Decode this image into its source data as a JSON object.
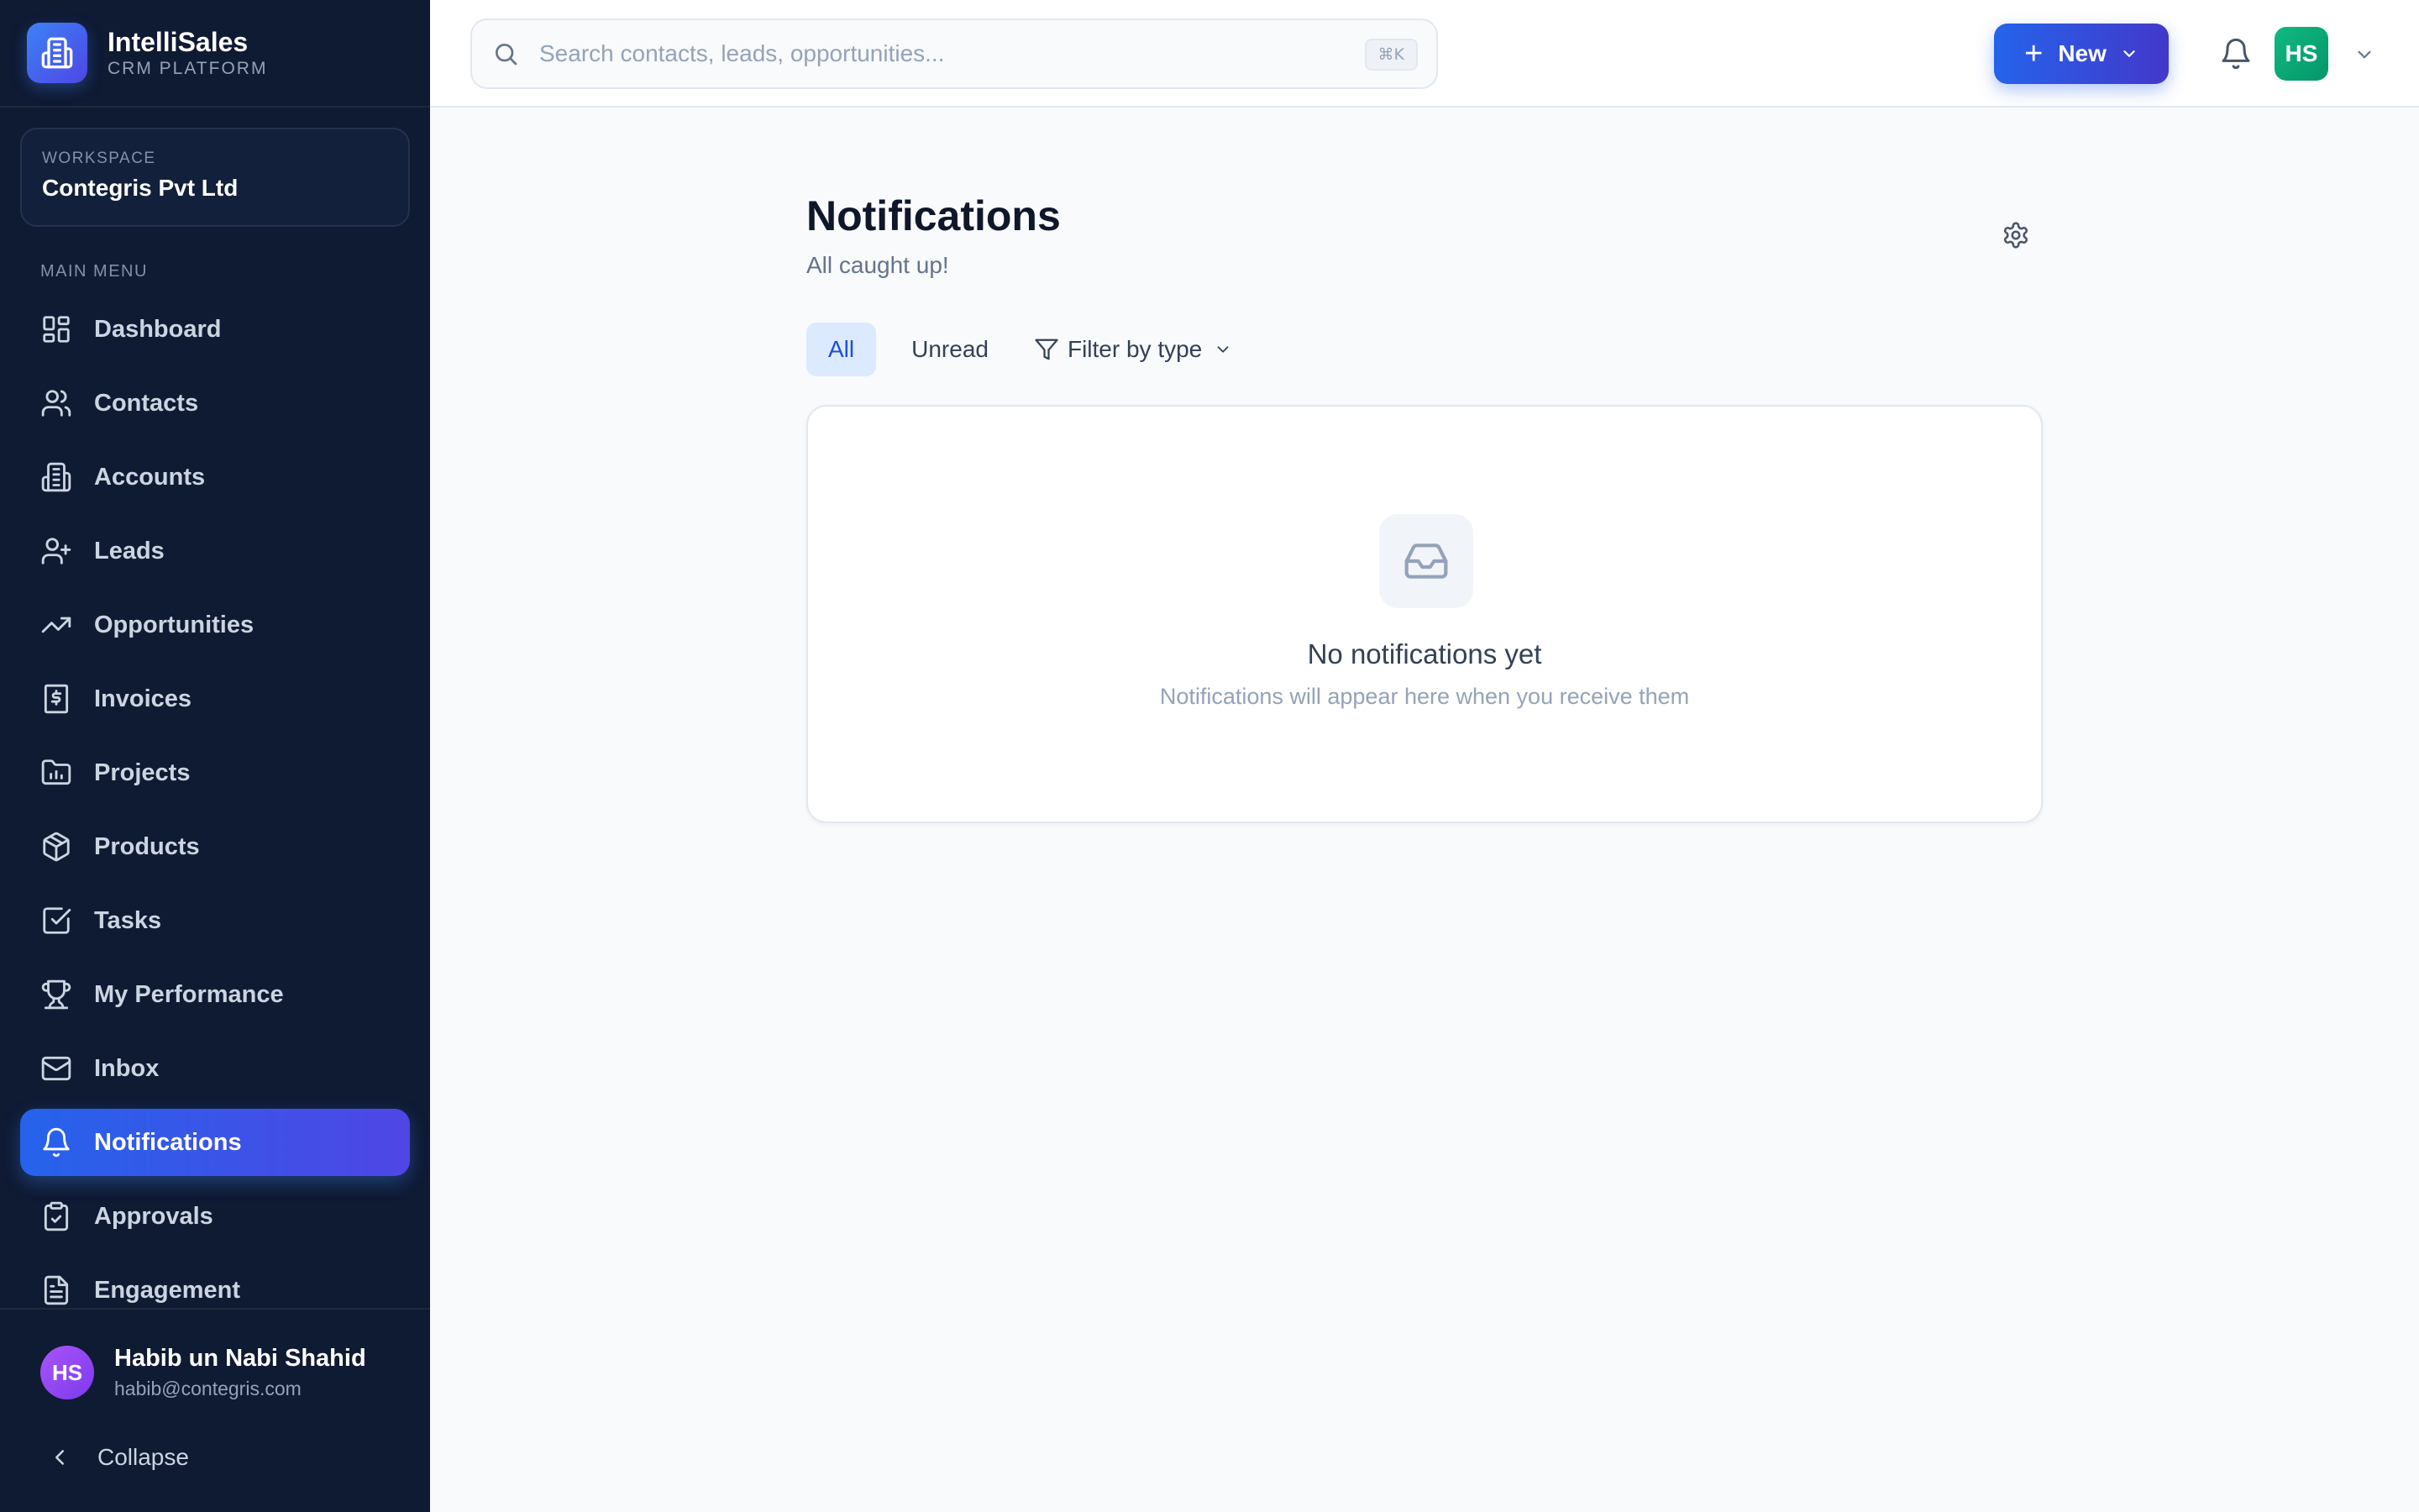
{
  "brand": {
    "name": "IntelliSales",
    "subtitle": "CRM PLATFORM"
  },
  "workspace": {
    "label": "WORKSPACE",
    "name": "Contegris Pvt Ltd"
  },
  "sidebar": {
    "section_label": "MAIN MENU",
    "items": [
      {
        "label": "Dashboard",
        "icon": "dashboard-icon"
      },
      {
        "label": "Contacts",
        "icon": "users-icon"
      },
      {
        "label": "Accounts",
        "icon": "building-icon"
      },
      {
        "label": "Leads",
        "icon": "user-plus-icon"
      },
      {
        "label": "Opportunities",
        "icon": "trending-up-icon"
      },
      {
        "label": "Invoices",
        "icon": "receipt-icon"
      },
      {
        "label": "Projects",
        "icon": "folder-chart-icon"
      },
      {
        "label": "Products",
        "icon": "package-icon"
      },
      {
        "label": "Tasks",
        "icon": "checkbox-icon"
      },
      {
        "label": "My Performance",
        "icon": "trophy-icon"
      },
      {
        "label": "Inbox",
        "icon": "mail-icon"
      },
      {
        "label": "Notifications",
        "icon": "bell-icon",
        "active": true
      },
      {
        "label": "Approvals",
        "icon": "clipboard-check-icon"
      },
      {
        "label": "Engagement",
        "icon": "file-text-icon"
      }
    ],
    "user": {
      "initials": "HS",
      "name": "Habib un Nabi Shahid",
      "email": "habib@contegris.com"
    },
    "collapse_label": "Collapse"
  },
  "header": {
    "search_placeholder": "Search contacts, leads, opportunities...",
    "search_shortcut": "⌘K",
    "new_button_label": "New",
    "avatar_initials": "HS"
  },
  "main": {
    "title": "Notifications",
    "subtitle": "All caught up!",
    "tabs": [
      {
        "label": "All",
        "active": true
      },
      {
        "label": "Unread"
      }
    ],
    "filter_label": "Filter by type",
    "empty_state": {
      "title": "No notifications yet",
      "message": "Notifications will appear here when you receive them"
    }
  },
  "colors": {
    "sidebar_bg": "#0f1a33",
    "accent": "#2563eb",
    "accent_end": "#4f46e5",
    "page_bg": "#f8fafc",
    "avatar_user": "#a855f7",
    "avatar_top": "#10b981"
  }
}
